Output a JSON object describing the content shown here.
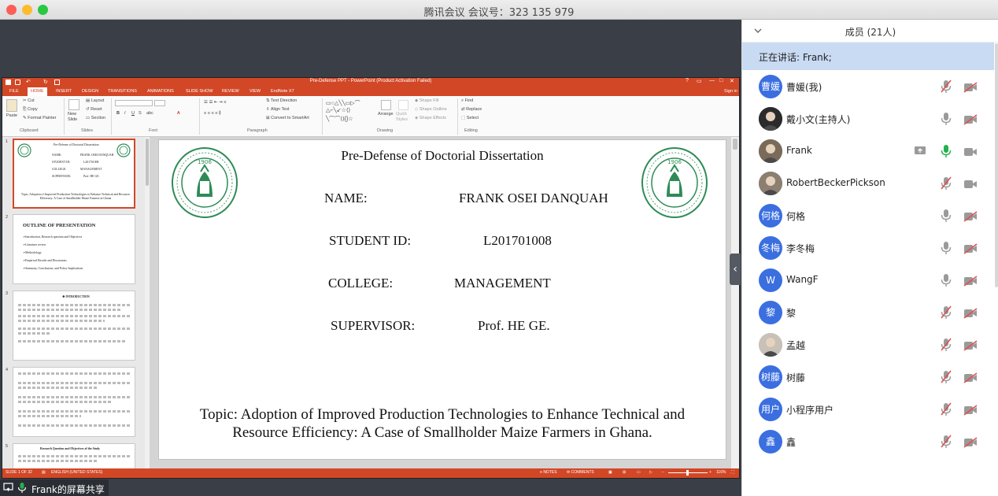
{
  "meeting": {
    "title": "腾讯会议 会议号：323 135 979",
    "share_label": "Frank的屏幕共享"
  },
  "ppt": {
    "window_title": "Pre-Defense PPT - PowerPoint (Product Activation Failed)",
    "window_controls": [
      "?",
      "▭",
      "—",
      "□",
      "✕"
    ],
    "sign_in": "Sign in",
    "tabs": [
      "FILE",
      "HOME",
      "INSERT",
      "DESIGN",
      "TRANSITIONS",
      "ANIMATIONS",
      "SLIDE SHOW",
      "REVIEW",
      "VIEW",
      "EndNote X7"
    ],
    "active_tab": "HOME",
    "ribbon": {
      "paste": "Paste",
      "cut": "Cut",
      "copy": "Copy",
      "format_painter": "Format Painter",
      "clipboard": "Clipboard",
      "new_slide": "New Slide",
      "layout": "Layout",
      "reset": "Reset",
      "section": "Section",
      "slides": "Slides",
      "font": "Font",
      "text_direction": "Text Direction",
      "align_text": "Align Text",
      "convert_smartart": "Convert to SmartArt",
      "paragraph": "Paragraph",
      "arrange": "Arrange",
      "quick_styles": "Quick Styles",
      "shape_fill": "Shape Fill",
      "shape_outline": "Shape Outline",
      "shape_effects": "Shape Effects",
      "drawing": "Drawing",
      "find": "Find",
      "replace": "Replace",
      "select": "Select",
      "editing": "Editing"
    },
    "thumbnails": [
      {
        "num": "1",
        "title": "Pre-Defense of Doctorial Dissertation",
        "rows": [
          [
            "NAME:",
            "FRANK OSEI DANQUAH"
          ],
          [
            "STUDENT ID:",
            "L201701008"
          ],
          [
            "COLLEGE:",
            "MANAGEMENT"
          ],
          [
            "SUPERVISOR:",
            "Prof. HE GE."
          ]
        ],
        "topic": "Topic: Adoption of Improved Production Technologies to Enhance Technical and Resource Efficiency: A Case of Smallholder Maize Farmers in Ghana"
      },
      {
        "num": "2",
        "title": "OUTLINE OF PRESENTATION",
        "items": [
          "➢Introduction, Research question and Objectives",
          "➢Literature review",
          "➢Methodology",
          "➢Empirical Results and Discussions",
          "➢Summary, Conclusions, and Policy Implications"
        ]
      },
      {
        "num": "3",
        "title": "❖ INTRODUCTION"
      },
      {
        "num": "4"
      },
      {
        "num": "5",
        "title": "Research Question and Objectives of the Study"
      }
    ],
    "slide": {
      "title": "Pre-Defense of Doctorial Dissertation",
      "name_label": "NAME:",
      "name_value": "FRANK OSEI DANQUAH",
      "id_label": "STUDENT ID:",
      "id_value": "L201701008",
      "college_label": "COLLEGE:",
      "college_value": "MANAGEMENT",
      "supervisor_label": "SUPERVISOR:",
      "supervisor_value": "Prof. HE GE.",
      "topic_line1": "Topic: Adoption of Improved Production Technologies to Enhance Technical and",
      "topic_line2": "Resource Efficiency: A Case of Smallholder Maize Farmers in Ghana.",
      "logo_year": "1906"
    },
    "status": {
      "slide_count": "SLIDE 1 OF 32",
      "language": "ENGLISH (UNITED STATES)",
      "notes": "NOTES",
      "comments": "COMMENTS",
      "zoom": "116%"
    }
  },
  "members": {
    "header": "成员 (21人)",
    "speaking": "正在讲话: Frank;",
    "list": [
      {
        "name": "曹媛(我)",
        "avatar_text": "曹媛",
        "avatar_color": "#3b6fe0",
        "mic": "off",
        "cam": "off"
      },
      {
        "name": "戴小文(主持人)",
        "avatar_text": "",
        "avatar_color": "#2b2b2b",
        "mic": "on",
        "cam": "off"
      },
      {
        "name": "Frank",
        "avatar_text": "",
        "avatar_color": "#7a6a5a",
        "mic": "active",
        "cam": "on",
        "screen": true
      },
      {
        "name": "RobertBeckerPickson",
        "avatar_text": "",
        "avatar_color": "#8c7f72",
        "mic": "off",
        "cam": "on"
      },
      {
        "name": "何格",
        "avatar_text": "何格",
        "avatar_color": "#3b6fe0",
        "mic": "on",
        "cam": "off"
      },
      {
        "name": "李冬梅",
        "avatar_text": "冬梅",
        "avatar_color": "#3b6fe0",
        "mic": "on",
        "cam": "off"
      },
      {
        "name": "WangF",
        "avatar_text": "W",
        "avatar_color": "#3b6fe0",
        "mic": "on",
        "cam": "off"
      },
      {
        "name": "黎",
        "avatar_text": "黎",
        "avatar_color": "#3b6fe0",
        "mic": "off",
        "cam": "off"
      },
      {
        "name": "孟越",
        "avatar_text": "",
        "avatar_color": "#c7c1b8",
        "mic": "off",
        "cam": "off"
      },
      {
        "name": "树藤",
        "avatar_text": "树藤",
        "avatar_color": "#3b6fe0",
        "mic": "off",
        "cam": "off"
      },
      {
        "name": "小程序用户",
        "avatar_text": "用户",
        "avatar_color": "#3b6fe0",
        "mic": "off",
        "cam": "off"
      },
      {
        "name": "鑫",
        "avatar_text": "鑫",
        "avatar_color": "#3b6fe0",
        "mic": "off",
        "cam": "off"
      }
    ]
  },
  "colors": {
    "ppt_accent": "#d24726",
    "tencent_blue": "#3b6fe0",
    "speaking_bg": "#c9daf3",
    "mic_active": "#22b14c"
  }
}
